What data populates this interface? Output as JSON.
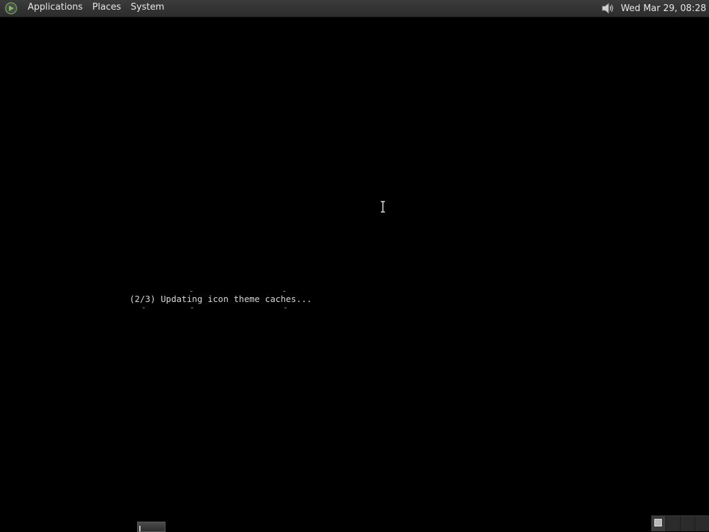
{
  "top_panel": {
    "menus": [
      {
        "label": "Applications"
      },
      {
        "label": "Places"
      },
      {
        "label": "System"
      }
    ],
    "distro_logo_icon": "distro-logo-icon",
    "tray": {
      "volume_icon": "volume-icon",
      "clock": "Wed Mar 29, 08:28"
    }
  },
  "console": {
    "line": "(2/3) Updating icon theme caches..."
  },
  "bottom_panel": {
    "workspaces": [
      {
        "active": true
      },
      {
        "active": false
      },
      {
        "active": false
      },
      {
        "active": false
      }
    ]
  },
  "colors": {
    "panel": "#333333",
    "desktop": "#000000",
    "text": "#e8e8e8"
  }
}
